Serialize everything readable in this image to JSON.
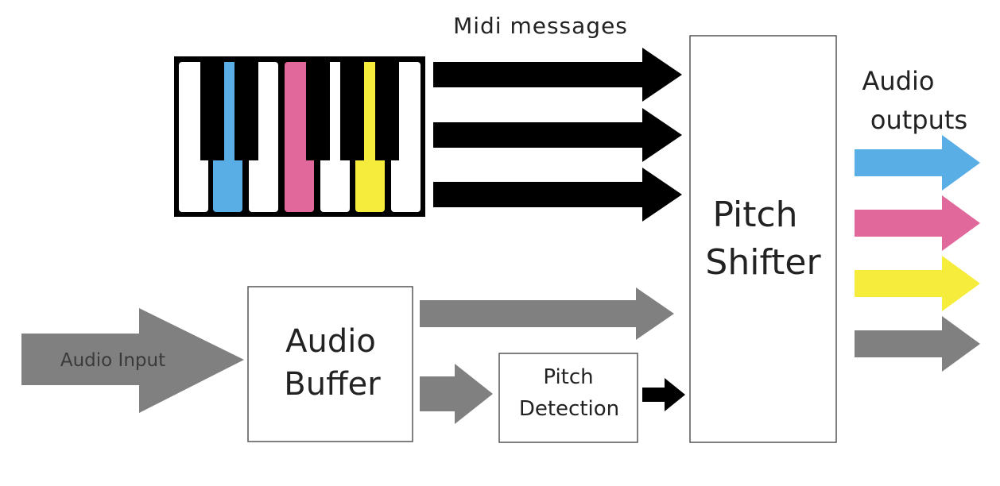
{
  "labels": {
    "midi_messages": "Midi messages",
    "audio_outputs_line1": "Audio",
    "audio_outputs_line2": "outputs",
    "pitch_shifter_line1": "Pitch",
    "pitch_shifter_line2": "Shifter",
    "audio_input": "Audio Input",
    "audio_buffer_line1": "Audio",
    "audio_buffer_line2": "Buffer",
    "pitch_detection_line1": "Pitch",
    "pitch_detection_line2": "Detection"
  },
  "colors": {
    "blue": "#5aaee6",
    "pink": "#e0689a",
    "yellow": "#f5ec3c",
    "gray": "#7f7f7f",
    "black": "#000000"
  },
  "keyboard": {
    "white_keys": [
      "white",
      "blue",
      "white",
      "pink",
      "white",
      "yellow",
      "white"
    ]
  },
  "outputs": [
    "blue",
    "pink",
    "yellow",
    "gray"
  ]
}
